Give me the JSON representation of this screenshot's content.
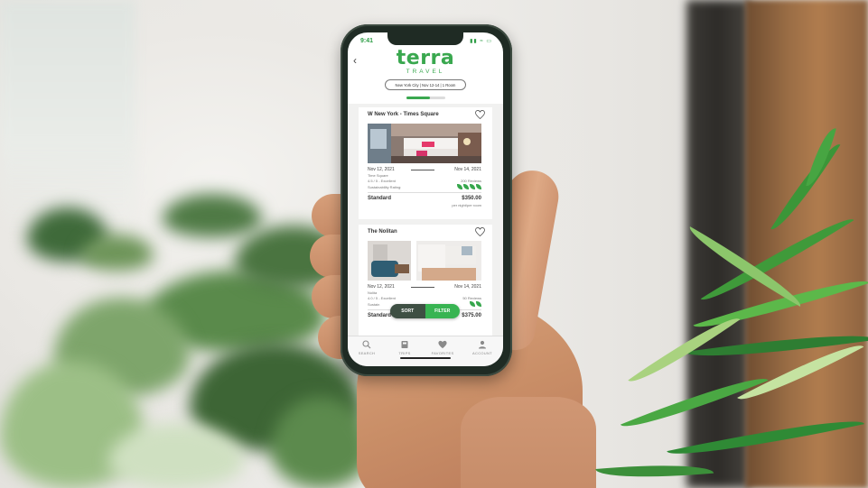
{
  "app": {
    "brand": "terra",
    "brand_sub": "TRAVEL",
    "accent_color": "#3aa84f"
  },
  "status_bar": {
    "time": "9:41",
    "icons": [
      "signal-icon",
      "wifi-icon",
      "battery-icon"
    ]
  },
  "search_summary": {
    "text": "New York City  |  Nov 12-14  |  1 Room",
    "progress": 0.6
  },
  "hotels": [
    {
      "name": "W New York - Times Square",
      "check_in": "Nov 12, 2021",
      "check_out": "Nov 14, 2021",
      "location": "Time Square",
      "rating": "4.5 / 5 - Excellent",
      "reviews": "200 Reviews",
      "sustainability_label": "Sustainability Rating:",
      "sustainability_leaves": 4,
      "room_type": "Standard",
      "price": "$350.00",
      "price_note": "per night/per room"
    },
    {
      "name": "The Nolitan",
      "check_in": "Nov 12, 2021",
      "check_out": "Nov 14, 2021",
      "location": "Nolita",
      "rating": "4.0 / 5 - Excellent",
      "reviews": "50 Reviews",
      "sustainability_label": "Sustain",
      "sustainability_leaves": 2,
      "room_type": "Standard",
      "price": "$375.00"
    }
  ],
  "actions": {
    "sort_label": "SORT",
    "filter_label": "FILTER"
  },
  "tabbar": [
    {
      "label": "SEARCH",
      "icon": "search-icon"
    },
    {
      "label": "TRIPS",
      "icon": "trips-icon"
    },
    {
      "label": "FAVORITES",
      "icon": "heart-icon"
    },
    {
      "label": "ACCOUNT",
      "icon": "account-icon"
    }
  ]
}
